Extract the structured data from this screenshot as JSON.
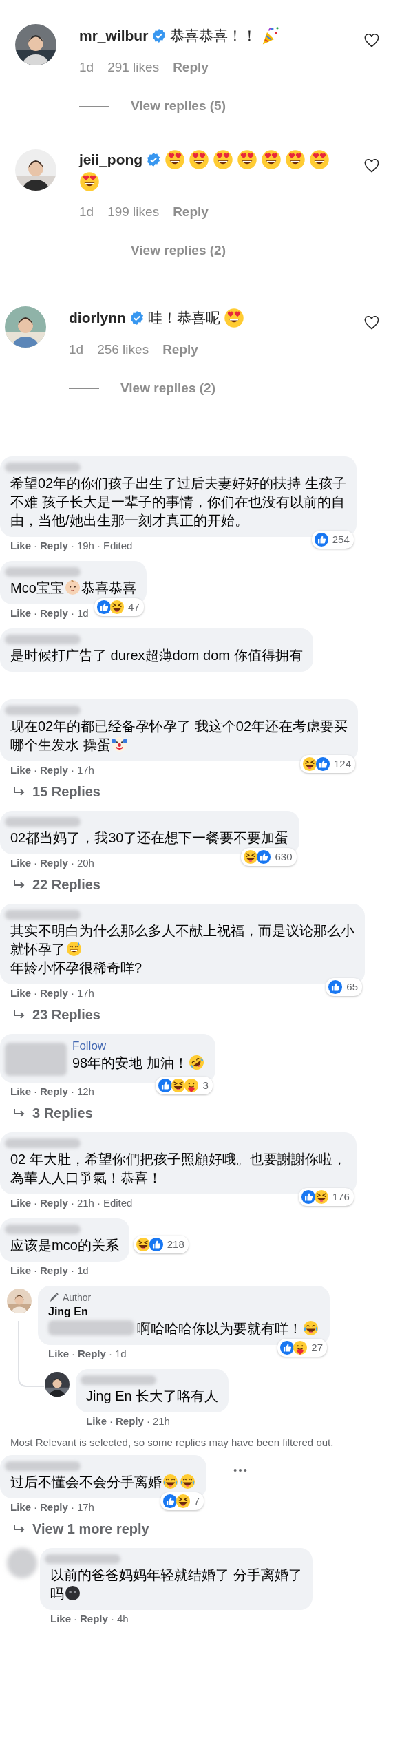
{
  "separator": "·",
  "instagram_comments": [
    {
      "username": "mr_wilbur",
      "text": "恭喜恭喜！！",
      "time": "1d",
      "likes": "291 likes",
      "reply": "Reply",
      "view_replies": "View replies (5)"
    },
    {
      "username": "jeii_pong",
      "time": "1d",
      "likes": "199 likes",
      "reply": "Reply",
      "view_replies": "View replies (2)"
    },
    {
      "username": "diorlynn",
      "text": "哇！恭喜呢",
      "time": "1d",
      "likes": "256 likes",
      "reply": "Reply",
      "view_replies": "View replies (2)"
    }
  ],
  "facebook_comments": [
    {
      "lines": [
        "希望02年的你们孩子出生了过后夫妻好好的扶持 生孩子",
        "不难 孩子长大是一辈子的事情，你们在也没有以前的自",
        "由，当他/她出生那一刻才真正的开始。"
      ],
      "reaction_count": "254",
      "actions": [
        "Like",
        "Reply",
        "19h",
        "Edited"
      ]
    },
    {
      "lines": [
        [
          "Mco宝宝",
          "恭喜恭喜"
        ]
      ],
      "reaction_count": "47",
      "actions": [
        "Like",
        "Reply",
        "1d"
      ]
    },
    {
      "lines": [
        "是时候打广告了 durex超薄dom dom 你值得拥有"
      ]
    },
    {
      "lines": [
        "现在02年的都已经备孕怀孕了 我这个02年还在考虑要买",
        "哪个生发水 操蛋"
      ],
      "reaction_count": "124",
      "actions": [
        "Like",
        "Reply",
        "17h"
      ],
      "replies_link": "15 Replies"
    },
    {
      "lines": [
        "02都当妈了，我30了还在想下一餐要不要加蛋"
      ],
      "reaction_count": "630",
      "actions": [
        "Like",
        "Reply",
        "20h"
      ],
      "replies_link": "22 Replies"
    },
    {
      "lines": [
        "其实不明白为什么那么多人不献上祝福，而是议论那么小",
        "就怀孕了",
        "年龄小怀孕很稀奇咩?"
      ],
      "reaction_count": "65",
      "actions": [
        "Like",
        "Reply",
        "17h"
      ],
      "replies_link": "23 Replies"
    },
    {
      "follow": "Follow",
      "lines": [
        "98年的安地 加油！"
      ],
      "reaction_count": "3",
      "actions": [
        "Like",
        "Reply",
        "12h"
      ],
      "replies_link": "3 Replies"
    },
    {
      "lines": [
        "02 年大肚，希望你們把孩子照顧好哦。也要謝謝你啦，",
        "為華人人口爭氣！恭喜！"
      ],
      "reaction_count": "176",
      "actions": [
        "Like",
        "Reply",
        "21h",
        "Edited"
      ]
    },
    {
      "lines": [
        "应该是mco的关系"
      ],
      "reaction_count": "218",
      "actions": [
        "Like",
        "Reply",
        "1d"
      ],
      "replies": [
        {
          "badge": "Author",
          "name": "Jing En",
          "lines": [
            "啊哈哈哈你以为要就有咩！"
          ],
          "reaction_count": "27",
          "actions": [
            "Like",
            "Reply",
            "1d"
          ],
          "replies": [
            {
              "lines": [
                "Jing En 长大了咯有人"
              ],
              "actions": [
                "Like",
                "Reply",
                "21h"
              ]
            }
          ]
        }
      ],
      "filter_note": "Most Relevant is selected, so some replies may have been filtered out."
    },
    {
      "lines": [
        "过后不懂会不会分手离婚"
      ],
      "reaction_count": "7",
      "actions": [
        "Like",
        "Reply",
        "17h"
      ],
      "options_menu": true,
      "replies_link": "View 1 more reply",
      "replies": [
        {
          "lines": [
            "以前的爸爸妈妈年轻就结婚了 分手离婚了",
            "吗"
          ],
          "actions": [
            "Like",
            "Reply",
            "4h"
          ]
        }
      ]
    }
  ]
}
